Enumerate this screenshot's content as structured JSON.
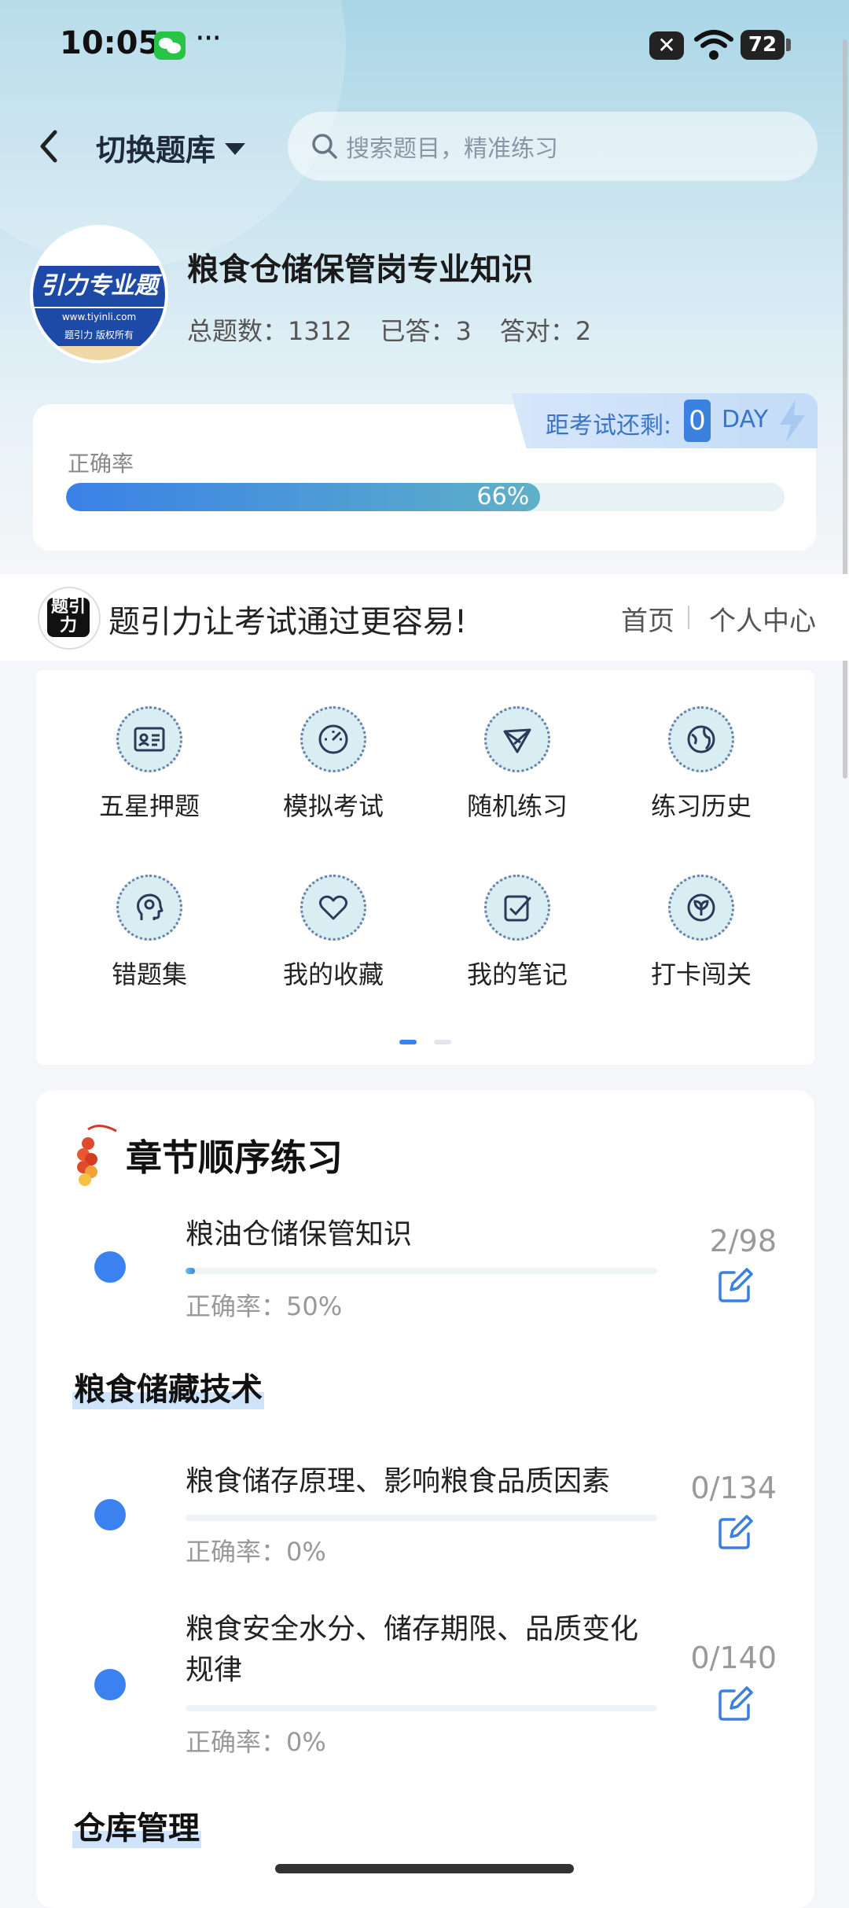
{
  "status": {
    "time": "10:05",
    "dots": "···",
    "battery": "72",
    "x_label": "✕"
  },
  "header": {
    "switch_label": "切换题库",
    "search_placeholder": "搜索题目，精准练习"
  },
  "bank": {
    "title": "粮食仓储保管岗专业知识",
    "logo_text": "引力专业题",
    "logo_url": "www.tiyinli.com",
    "logo_small": "题引力 版权所有",
    "stats": [
      {
        "label": "总题数：",
        "value": "1312"
      },
      {
        "label": "已答：",
        "value": "3"
      },
      {
        "label": "答对：",
        "value": "2"
      }
    ]
  },
  "countdown": {
    "label": "距考试还剩:",
    "value": "0",
    "unit": "DAY"
  },
  "accuracy": {
    "label": "正确率",
    "text": "66%",
    "percent": 66
  },
  "slogan": {
    "logo_text": "题引力",
    "text": "题引力让考试通过更容易!",
    "home": "首页",
    "me": "个人中心"
  },
  "features": [
    {
      "label": "五星押题",
      "icon": "id-card-icon"
    },
    {
      "label": "模拟考试",
      "icon": "gauge-icon"
    },
    {
      "label": "随机练习",
      "icon": "shuffle-icon"
    },
    {
      "label": "练习历史",
      "icon": "globe-icon"
    },
    {
      "label": "错题集",
      "icon": "head-icon"
    },
    {
      "label": "我的收藏",
      "icon": "heart-icon"
    },
    {
      "label": "我的笔记",
      "icon": "note-icon"
    },
    {
      "label": "打卡闯关",
      "icon": "seedling-icon"
    }
  ],
  "chapters": {
    "title": "章节顺序练习",
    "sections": [
      {
        "title": "",
        "items": [
          {
            "title": "粮油仓储保管知识",
            "acc": "正确率：50%",
            "count": "2/98",
            "progress": 0.02
          }
        ]
      },
      {
        "title": "粮食储藏技术",
        "items": [
          {
            "title": "粮食储存原理、影响粮食品质因素",
            "acc": "正确率：0%",
            "count": "0/134",
            "progress": 0
          },
          {
            "title": "粮食安全水分、储存期限、品质变化规律",
            "acc": "正确率：0%",
            "count": "0/140",
            "progress": 0
          }
        ]
      },
      {
        "title": "仓库管理",
        "items": []
      }
    ]
  },
  "colors": {
    "accent": "#3b82f0",
    "brand_dark": "#1d4aa6"
  }
}
